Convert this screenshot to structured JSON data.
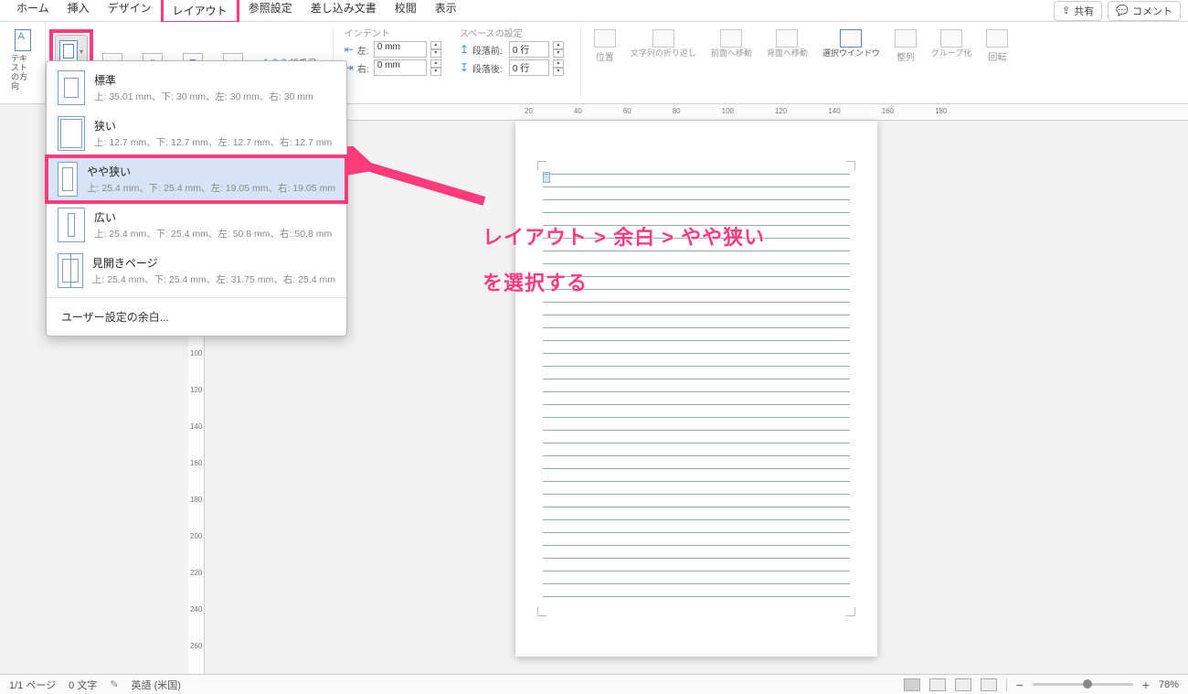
{
  "menu": {
    "home": "ホーム",
    "insert": "挿入",
    "design": "デザイン",
    "layout": "レイアウト",
    "references": "参照設定",
    "mailings": "差し込み文書",
    "review": "校閲",
    "view": "表示"
  },
  "topright": {
    "share": "共有",
    "comment": "コメント"
  },
  "ribbon": {
    "text_direction": "テキストの方向",
    "line_numbers": "行番号",
    "indent_title": "インデント",
    "indent_left_label": "左:",
    "indent_right_label": "右:",
    "indent_left_value": "0 mm",
    "indent_right_value": "0 mm",
    "spacing_title": "スペースの設定",
    "spacing_before_label": "段落前:",
    "spacing_after_label": "段落後:",
    "spacing_before_value": "0 行",
    "spacing_after_value": "0 行",
    "position": "位置",
    "wrap": "文字列の折り返し",
    "forward": "前面へ移動",
    "backward": "背面へ移動",
    "selection_pane": "選択ウインドウ",
    "align": "整列",
    "group": "グループ化",
    "rotate": "回転"
  },
  "dropdown": {
    "normal": {
      "title": "標準",
      "detail": "上: 35.01 mm、下: 30 mm、左: 30 mm、右: 30 mm"
    },
    "narrow": {
      "title": "狭い",
      "detail": "上: 12.7 mm、下: 12.7 mm、左: 12.7 mm、右: 12.7 mm"
    },
    "moderate": {
      "title": "やや狭い",
      "detail": "上: 25.4 mm、下: 25.4 mm、左: 19.05 mm、右: 19.05 mm"
    },
    "wide": {
      "title": "広い",
      "detail": "上: 25.4 mm、下: 25.4 mm、左: 50.8 mm、右: 50.8 mm"
    },
    "mirrored": {
      "title": "見開きページ",
      "detail": "上: 25.4 mm、下: 25.4 mm、左: 31.75 mm、右: 25.4 mm"
    },
    "custom": "ユーザー設定の余白..."
  },
  "ruler_h": [
    "20",
    "40",
    "60",
    "80",
    "100",
    "120",
    "140",
    "160",
    "180"
  ],
  "ruler_v": [
    "100",
    "120",
    "140",
    "160",
    "180",
    "200",
    "220",
    "240",
    "260"
  ],
  "annotation": {
    "line1": "レイアウト > 余白 > やや狭い",
    "line2": "を選択する"
  },
  "status": {
    "page": "1/1 ページ",
    "words": "0 文字",
    "lang": "英語 (米国)",
    "zoom": "78%"
  }
}
